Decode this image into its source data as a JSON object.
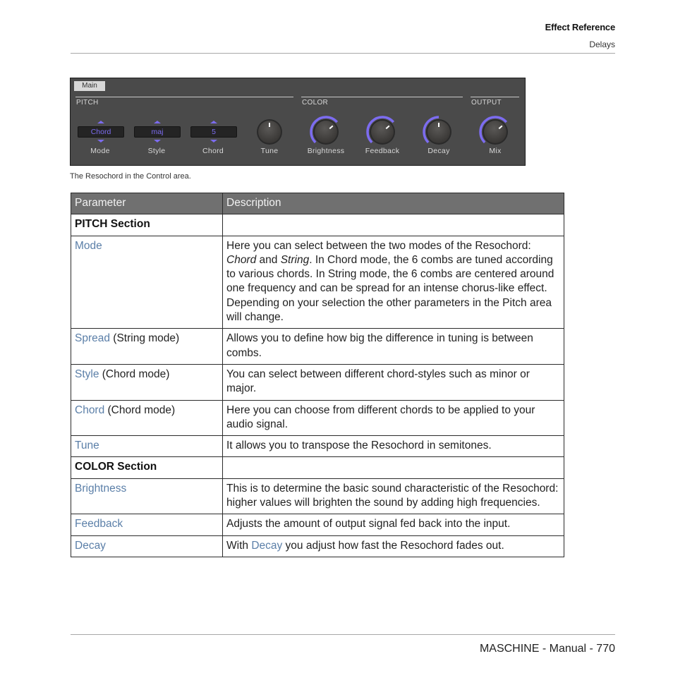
{
  "header": {
    "title": "Effect Reference",
    "subtitle": "Delays"
  },
  "panel": {
    "tab": "Main",
    "accent_color": "#7c6cf0",
    "sections": [
      {
        "label": "PITCH"
      },
      {
        "label": "COLOR"
      },
      {
        "label": "OUTPUT"
      }
    ],
    "selectors": [
      {
        "label": "Mode",
        "value": "Chord"
      },
      {
        "label": "Style",
        "value": "maj"
      },
      {
        "label": "Chord",
        "value": "5"
      }
    ],
    "knobs": [
      {
        "label": "Tune",
        "value": 0.5,
        "bipolar": true
      },
      {
        "label": "Brightness",
        "value": 0.68,
        "bipolar": false
      },
      {
        "label": "Feedback",
        "value": 0.68,
        "bipolar": false
      },
      {
        "label": "Decay",
        "value": 0.5,
        "bipolar": false
      },
      {
        "label": "Mix",
        "value": 0.68,
        "bipolar": false
      }
    ]
  },
  "caption": "The Resochord in the Control area.",
  "table": {
    "headers": [
      "Parameter",
      "Description"
    ],
    "rows": [
      {
        "type": "section",
        "param": "PITCH Section"
      },
      {
        "type": "param",
        "name": "Mode",
        "suffix": "",
        "desc_parts": [
          {
            "t": "Here you can select between the two modes of the Resochord: "
          },
          {
            "t": "Chord",
            "i": true
          },
          {
            "t": " and "
          },
          {
            "t": "String",
            "i": true
          },
          {
            "t": ". In Chord mode, the 6 combs are tuned according to various chords. In String mode, the 6 combs are centered around one frequency and can be spread for an intense chorus-like effect. Depending on your selection the other parameters in the Pitch area will change."
          }
        ]
      },
      {
        "type": "param",
        "name": "Spread",
        "suffix": " (String mode)",
        "desc_parts": [
          {
            "t": "Allows you to define how big the difference in tuning is between combs."
          }
        ]
      },
      {
        "type": "param",
        "name": "Style",
        "suffix": " (Chord mode)",
        "desc_parts": [
          {
            "t": "You can select between different chord-styles such as minor or major."
          }
        ]
      },
      {
        "type": "param",
        "name": "Chord",
        "suffix": " (Chord mode)",
        "desc_parts": [
          {
            "t": "Here you can choose from different chords to be applied to your audio signal."
          }
        ]
      },
      {
        "type": "param",
        "name": "Tune",
        "suffix": "",
        "desc_parts": [
          {
            "t": "It allows you to transpose the Resochord in semitones."
          }
        ]
      },
      {
        "type": "section",
        "param": "COLOR Section"
      },
      {
        "type": "param",
        "name": "Brightness",
        "suffix": "",
        "desc_parts": [
          {
            "t": "This is to determine the basic sound characteristic of the Resochord: higher values will brighten the sound by adding high frequencies."
          }
        ]
      },
      {
        "type": "param",
        "name": "Feedback",
        "suffix": "",
        "desc_parts": [
          {
            "t": "Adjusts the amount of output signal fed back into the input."
          }
        ]
      },
      {
        "type": "param",
        "name": "Decay",
        "suffix": "",
        "desc_parts": [
          {
            "t": "With "
          },
          {
            "t": "Decay",
            "link": true
          },
          {
            "t": " you adjust how fast the Resochord fades out."
          }
        ]
      }
    ]
  },
  "footer": {
    "text": "MASCHINE - Manual - 770"
  }
}
